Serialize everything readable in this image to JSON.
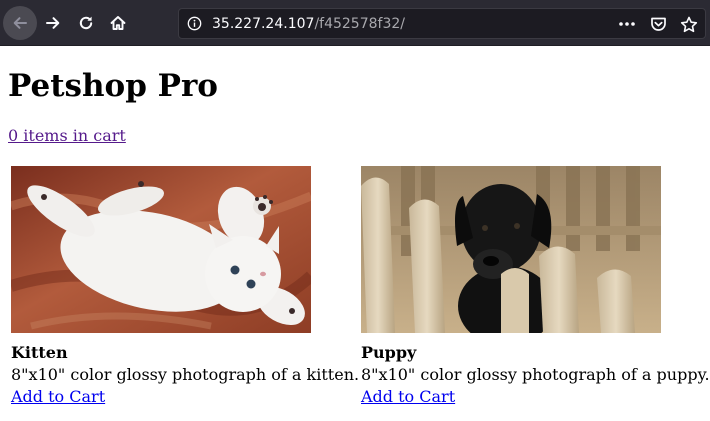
{
  "browser": {
    "url_host": "35.227.24.107",
    "url_path": "/f452578f32/",
    "icons": [
      "back-icon",
      "forward-icon",
      "reload-icon",
      "home-icon",
      "info-icon",
      "more-icon",
      "pocket-icon",
      "bookmark-star-icon"
    ]
  },
  "page": {
    "title": "Petshop Pro",
    "cart_link": "0 items in cart"
  },
  "products": [
    {
      "name": "Kitten",
      "description": "8\"x10\" color glossy photograph of a kitten.",
      "action": "Add to Cart"
    },
    {
      "name": "Puppy",
      "description": "8\"x10\" color glossy photograph of a puppy.",
      "action": "Add to Cart"
    }
  ],
  "colors": {
    "toolbar": "#2b2a33",
    "urlbar": "#1c1b22",
    "visited_link": "#551a8b",
    "link": "#0000ee"
  }
}
